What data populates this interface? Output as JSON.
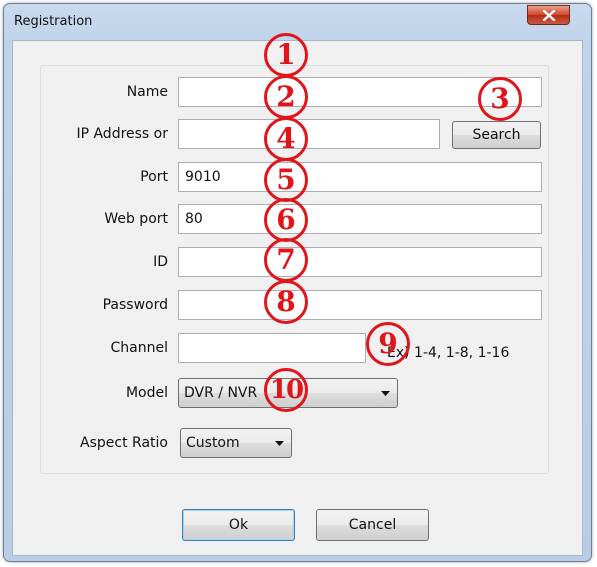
{
  "window": {
    "title": "Registration"
  },
  "fields": {
    "name": {
      "label": "Name",
      "value": ""
    },
    "ip": {
      "label": "IP Address or",
      "value": ""
    },
    "port": {
      "label": "Port",
      "value": "9010"
    },
    "web_port": {
      "label": "Web port",
      "value": "80"
    },
    "id": {
      "label": "ID",
      "value": ""
    },
    "password": {
      "label": "Password",
      "value": ""
    },
    "channel": {
      "label": "Channel",
      "value": "",
      "hint": "Ex) 1-4, 1-8, 1-16"
    },
    "model": {
      "label": "Model",
      "value": "DVR / NVR"
    },
    "aspect": {
      "label": "Aspect Ratio",
      "value": "Custom"
    }
  },
  "buttons": {
    "search": "Search",
    "ok": "Ok",
    "cancel": "Cancel"
  },
  "markers": [
    "1",
    "2",
    "3",
    "4",
    "5",
    "6",
    "7",
    "8",
    "9",
    "10"
  ],
  "colors": {
    "marker": "#e0151b",
    "close_button": "#c9462c"
  }
}
